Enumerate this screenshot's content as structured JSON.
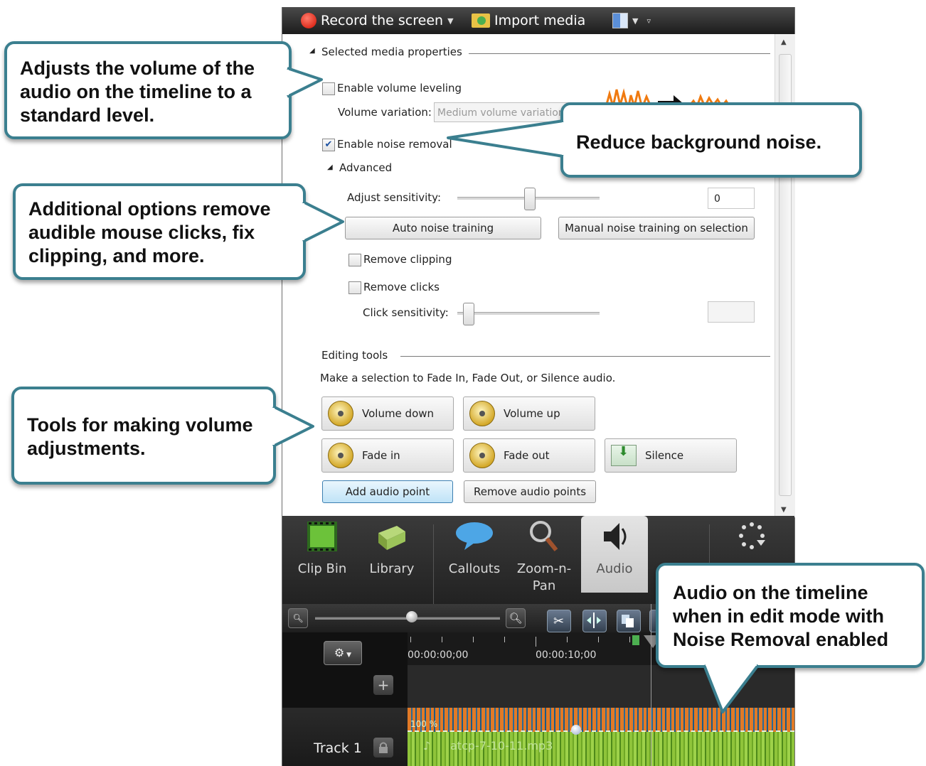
{
  "toolbar": {
    "record_label": "Record the screen",
    "import_label": "Import media"
  },
  "panel": {
    "section_title": "Selected media properties",
    "enable_volume_leveling": {
      "label": "Enable volume leveling",
      "checked": false
    },
    "volume_variation": {
      "label": "Volume variation:",
      "value": "Medium volume variation"
    },
    "enable_noise_removal": {
      "label": "Enable noise removal",
      "checked": true
    },
    "advanced_label": "Advanced",
    "adjust_sensitivity": {
      "label": "Adjust sensitivity:",
      "value": "0"
    },
    "auto_noise_training": "Auto noise training",
    "manual_noise_training": "Manual noise training on selection",
    "remove_clipping": {
      "label": "Remove clipping",
      "checked": false
    },
    "remove_clicks": {
      "label": "Remove clicks",
      "checked": false
    },
    "click_sensitivity": {
      "label": "Click sensitivity:",
      "value": ""
    },
    "editing_tools_title": "Editing tools",
    "editing_tools_hint": "Make a selection to Fade In, Fade Out, or Silence audio.",
    "tools": {
      "volume_down": "Volume down",
      "volume_up": "Volume up",
      "fade_in": "Fade in",
      "fade_out": "Fade out",
      "silence": "Silence",
      "add_audio_point": "Add audio point",
      "remove_audio_points": "Remove audio points"
    }
  },
  "tabs": [
    {
      "label": "Clip Bin"
    },
    {
      "label": "Library"
    },
    {
      "label": "Callouts"
    },
    {
      "label": "Zoom-n-\nPan"
    },
    {
      "label": "Audio"
    }
  ],
  "timeline": {
    "time_start": "00:00:00;00",
    "time_mid": "00:00:10;00",
    "track_name": "Track 1",
    "clip_name": "atcp-7-10-11.mp3",
    "clip_level": "100 %"
  },
  "callouts": {
    "volume_leveling": "Adjusts the volume of the audio on the timeline to a standard level.",
    "noise": "Reduce background noise.",
    "additional": "Additional options remove audible mouse clicks, fix clipping, and more.",
    "tools": "Tools for making volume adjustments.",
    "timeline": "Audio on the timeline when in edit mode with Noise Removal enabled"
  },
  "colors": {
    "callout_border": "#3b7f8f",
    "waveform_orange": "#e27a26",
    "waveform_green": "#8fc43a"
  }
}
